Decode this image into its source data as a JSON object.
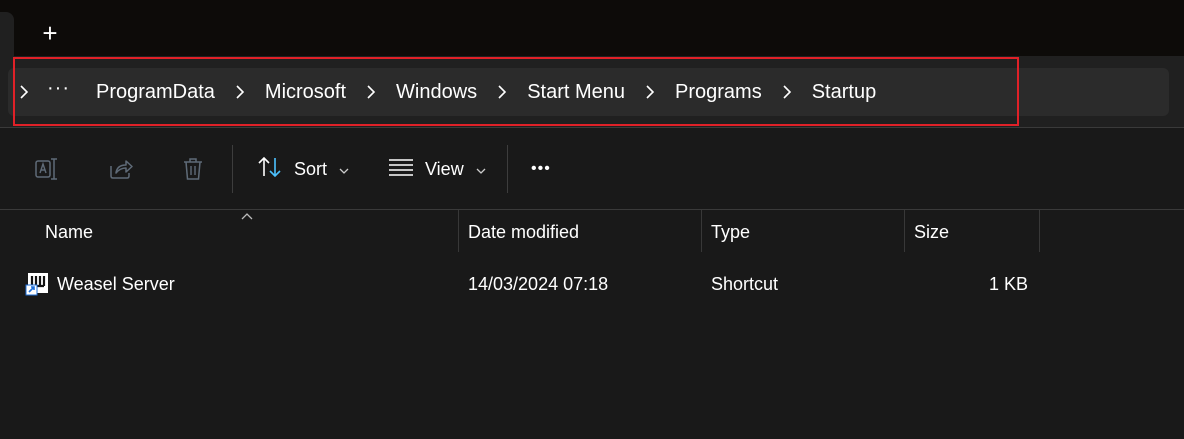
{
  "titlebar": {
    "new_tab_label": "+"
  },
  "breadcrumb": {
    "overflow": "···",
    "items": [
      "ProgramData",
      "Microsoft",
      "Windows",
      "Start Menu",
      "Programs",
      "Startup"
    ]
  },
  "toolbar": {
    "sort_label": "Sort",
    "view_label": "View",
    "more_label": "•••"
  },
  "columns": {
    "name": "Name",
    "date_modified": "Date modified",
    "type": "Type",
    "size": "Size"
  },
  "files": [
    {
      "name": "Weasel Server",
      "date_modified": "14/03/2024 07:18",
      "type": "Shortcut",
      "size": "1 KB"
    }
  ],
  "colors": {
    "highlight": "#e02128",
    "accent": "#4cc2ff"
  }
}
